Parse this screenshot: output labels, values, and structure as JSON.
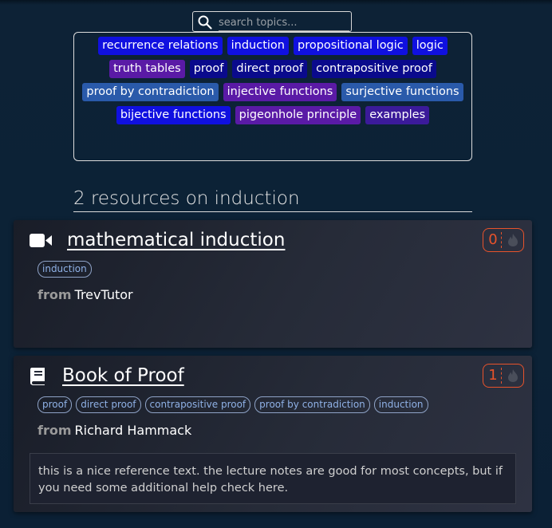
{
  "search": {
    "placeholder": "search topics..."
  },
  "topics": [
    {
      "label": "recurrence relations",
      "color": "blue"
    },
    {
      "label": "induction",
      "color": "blue"
    },
    {
      "label": "propositional logic",
      "color": "blue"
    },
    {
      "label": "logic",
      "color": "blue"
    },
    {
      "label": "truth tables",
      "color": "purple"
    },
    {
      "label": "proof",
      "color": "navy"
    },
    {
      "label": "direct proof",
      "color": "navy"
    },
    {
      "label": "contrapositive proof",
      "color": "navy"
    },
    {
      "label": "proof by contradiction",
      "color": "steel"
    },
    {
      "label": "injective functions",
      "color": "purple"
    },
    {
      "label": "surjective functions",
      "color": "steel"
    },
    {
      "label": "bijective functions",
      "color": "blue"
    },
    {
      "label": "pigeonhole principle",
      "color": "purple"
    },
    {
      "label": "examples",
      "color": "indigo"
    }
  ],
  "results": {
    "heading": "2 resources on induction"
  },
  "resources": [
    {
      "type_icon": "video-icon",
      "title": "mathematical induction",
      "votes": "0",
      "tags": [
        "induction"
      ],
      "from_label": "from",
      "author": "TrevTutor"
    },
    {
      "type_icon": "book-icon",
      "title": "Book of Proof",
      "votes": "1",
      "tags": [
        "proof",
        "direct proof",
        "contrapositive proof",
        "proof by contradiction",
        "induction"
      ],
      "from_label": "from",
      "author": "Richard Hammack",
      "note": "this is a nice reference text. the lecture notes are good for most concepts, but if you need some additional help check here."
    }
  ],
  "colors": {
    "background": "#0c2236",
    "vote_accent": "#e8532b",
    "chip_text": "#8fb1e6"
  }
}
